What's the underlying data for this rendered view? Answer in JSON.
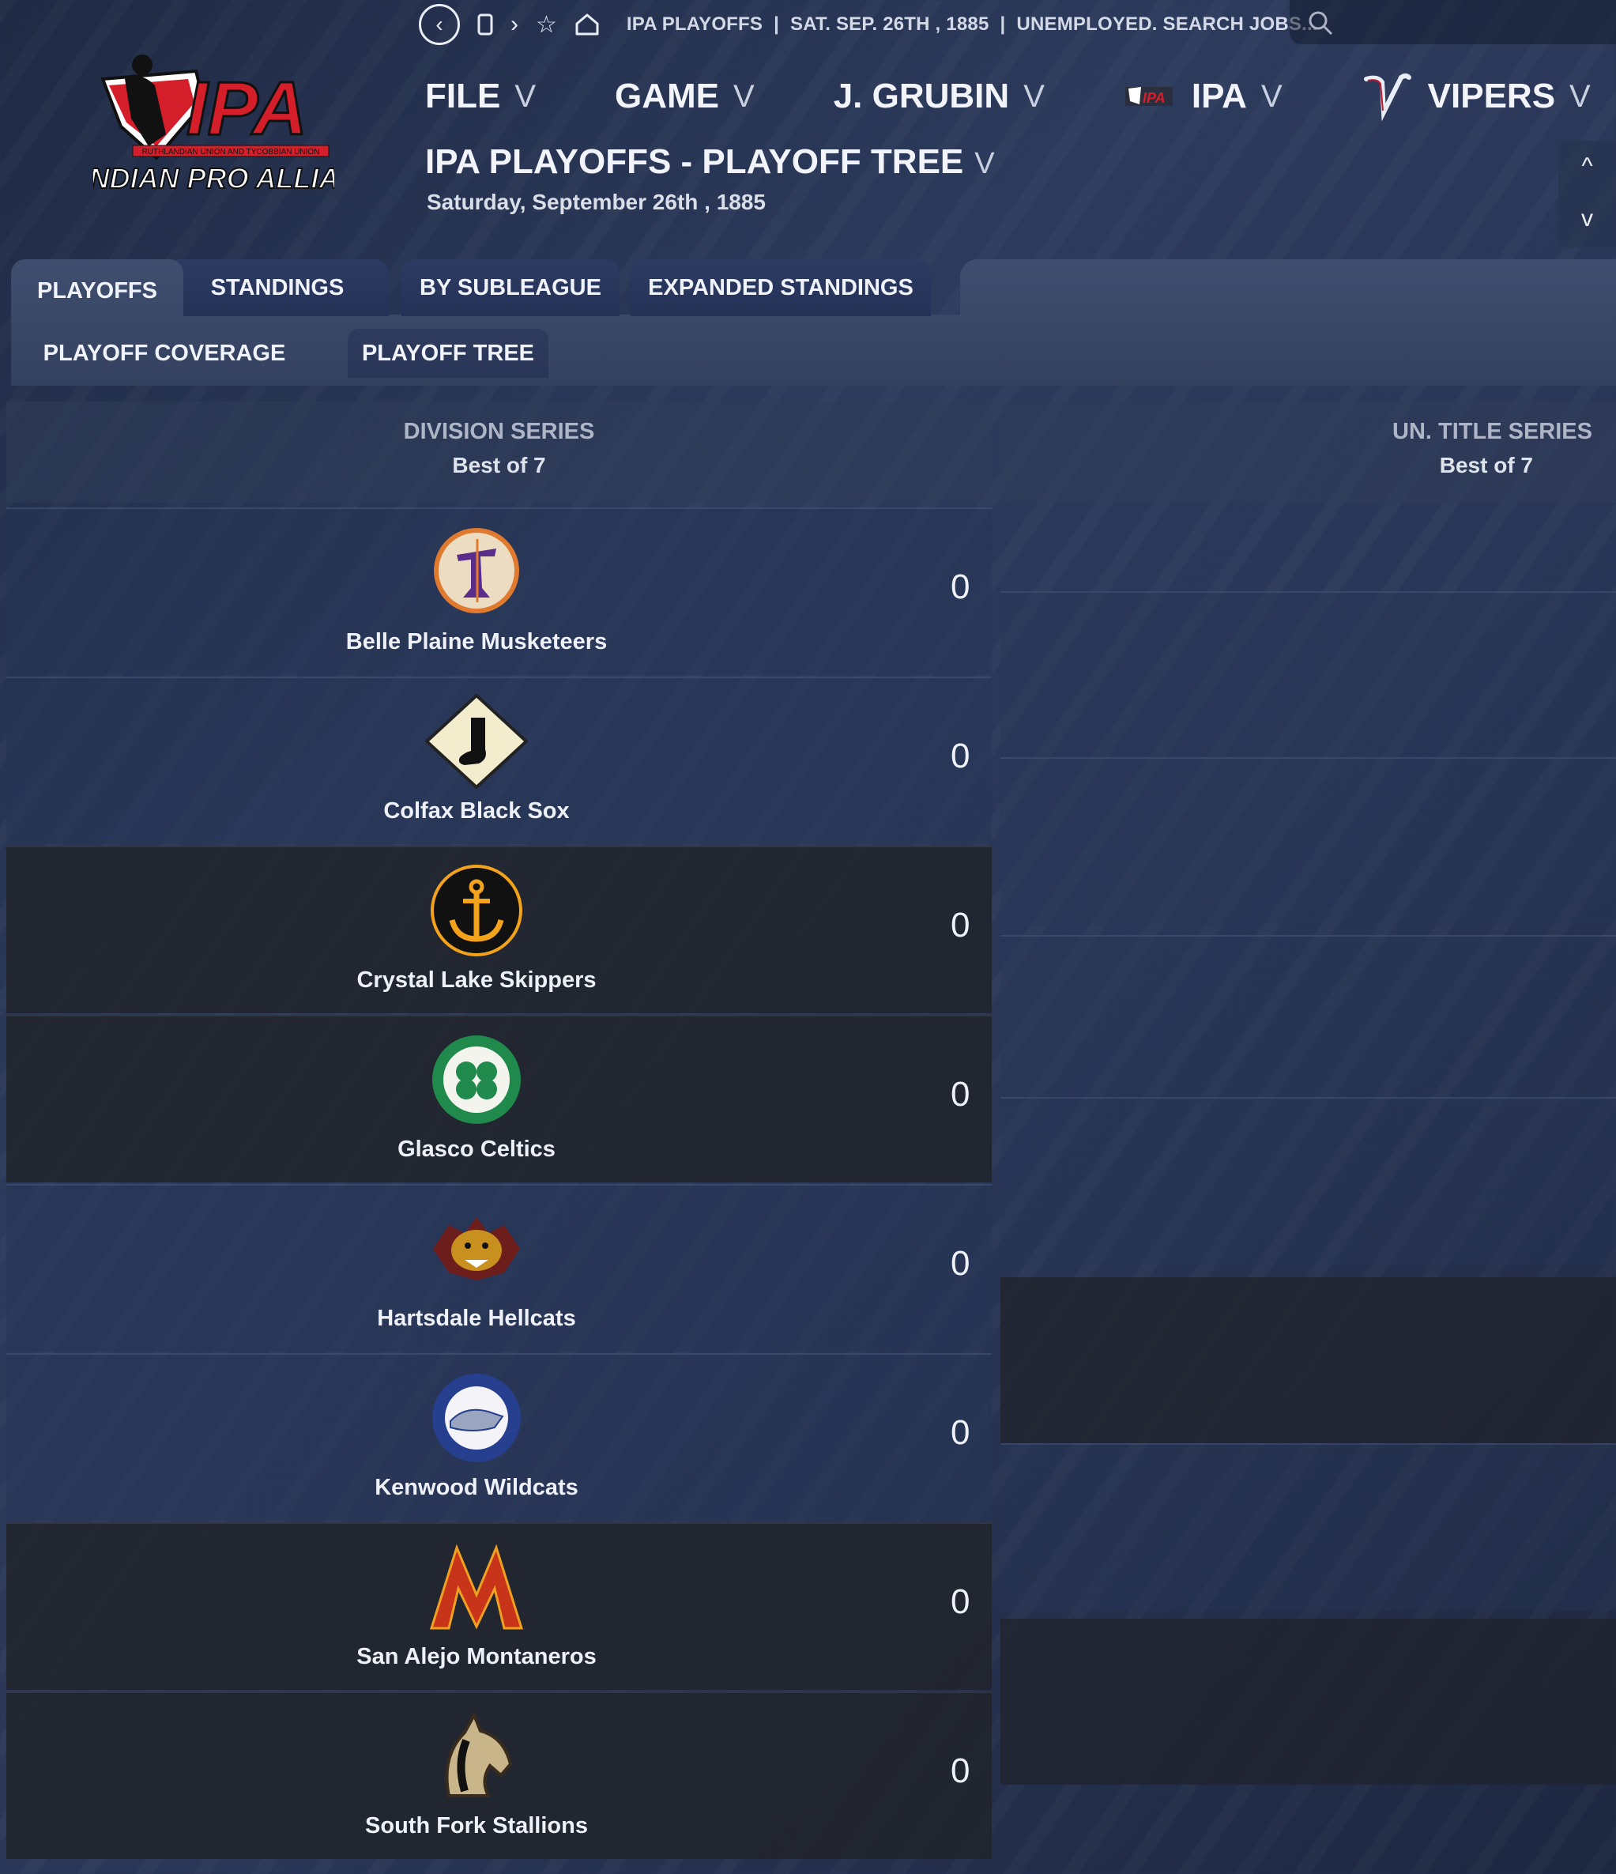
{
  "topbar": {
    "breadcrumb": [
      "IPA PLAYOFFS",
      "SAT. SEP. 26TH , 1885",
      "UNEMPLOYED. SEARCH JOBS..."
    ]
  },
  "logo": {
    "main": "IPA",
    "sub": "ISLANDIAN PRO ALLIANCE",
    "tiny": "RUTHLANDIAN UNION AND TYCOBBIAN UNION"
  },
  "menu": {
    "file": "FILE",
    "game": "GAME",
    "manager": "J. GRUBIN",
    "league": "IPA",
    "team": "VIPERS",
    "chevron": "V"
  },
  "page": {
    "title": "IPA PLAYOFFS - PLAYOFF TREE",
    "date": "Saturday, September 26th , 1885"
  },
  "scroll": {
    "up": "^",
    "down": "v"
  },
  "tabs": [
    "PLAYOFFS",
    "STANDINGS",
    "BY SUBLEAGUE",
    "EXPANDED STANDINGS"
  ],
  "subtabs": [
    "PLAYOFF COVERAGE",
    "PLAYOFF TREE"
  ],
  "bracket": {
    "division": {
      "title": "DIVISION SERIES",
      "format": "Best of 7"
    },
    "title_series": {
      "title": "UN. TITLE SERIES",
      "format": "Best of 7"
    },
    "teams": [
      {
        "name": "Belle Plaine Musketeers",
        "score": "0",
        "icon": "musketeer-icon",
        "color": "#e07a2f"
      },
      {
        "name": "Colfax Black Sox",
        "score": "0",
        "icon": "black-sock-icon",
        "color": "#1a1a1a"
      },
      {
        "name": "Crystal Lake Skippers",
        "score": "0",
        "icon": "anchor-icon",
        "color": "#f3a21c"
      },
      {
        "name": "Glasco Celtics",
        "score": "0",
        "icon": "clover-icon",
        "color": "#1f8a4c"
      },
      {
        "name": "Hartsdale Hellcats",
        "score": "0",
        "icon": "hellcat-icon",
        "color": "#c8901e"
      },
      {
        "name": "Kenwood Wildcats",
        "score": "0",
        "icon": "wildcat-icon",
        "color": "#263f8f"
      },
      {
        "name": "San Alejo Montaneros",
        "score": "0",
        "icon": "mountain-m-icon",
        "color": "#c8341a"
      },
      {
        "name": "South Fork Stallions",
        "score": "0",
        "icon": "stallion-icon",
        "color": "#c9b58a"
      }
    ]
  }
}
